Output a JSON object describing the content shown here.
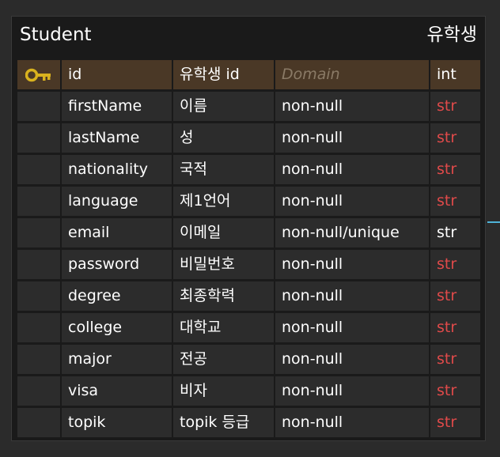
{
  "entity": {
    "name": "Student",
    "alias": "유학생",
    "highlight_color": "#e04a4a",
    "pk_color": "#4a3826",
    "rows": [
      {
        "name": "id",
        "logical": "유학생 id",
        "domain": "Domain",
        "type": "int",
        "pk": true,
        "domain_placeholder": true,
        "type_highlight": false,
        "key_icon": "key-icon"
      },
      {
        "name": "firstName",
        "logical": "이름",
        "domain": "non-null",
        "type": "str",
        "pk": false,
        "domain_placeholder": false,
        "type_highlight": true
      },
      {
        "name": "lastName",
        "logical": "성",
        "domain": "non-null",
        "type": "str",
        "pk": false,
        "domain_placeholder": false,
        "type_highlight": true
      },
      {
        "name": "nationality",
        "logical": "국적",
        "domain": "non-null",
        "type": "str",
        "pk": false,
        "domain_placeholder": false,
        "type_highlight": true
      },
      {
        "name": "language",
        "logical": "제1언어",
        "domain": "non-null",
        "type": "str",
        "pk": false,
        "domain_placeholder": false,
        "type_highlight": true
      },
      {
        "name": "email",
        "logical": "이메일",
        "domain": "non-null/unique",
        "type": "str",
        "pk": false,
        "domain_placeholder": false,
        "type_highlight": false
      },
      {
        "name": "password",
        "logical": "비밀번호",
        "domain": "non-null",
        "type": "str",
        "pk": false,
        "domain_placeholder": false,
        "type_highlight": true
      },
      {
        "name": "degree",
        "logical": "최종학력",
        "domain": "non-null",
        "type": "str",
        "pk": false,
        "domain_placeholder": false,
        "type_highlight": true
      },
      {
        "name": "college",
        "logical": "대학교",
        "domain": "non-null",
        "type": "str",
        "pk": false,
        "domain_placeholder": false,
        "type_highlight": true
      },
      {
        "name": "major",
        "logical": "전공",
        "domain": "non-null",
        "type": "str",
        "pk": false,
        "domain_placeholder": false,
        "type_highlight": true
      },
      {
        "name": "visa",
        "logical": "비자",
        "domain": "non-null",
        "type": "str",
        "pk": false,
        "domain_placeholder": false,
        "type_highlight": true
      },
      {
        "name": "topik",
        "logical": "topik 등급",
        "domain": "non-null",
        "type": "str",
        "pk": false,
        "domain_placeholder": false,
        "type_highlight": true
      }
    ]
  }
}
